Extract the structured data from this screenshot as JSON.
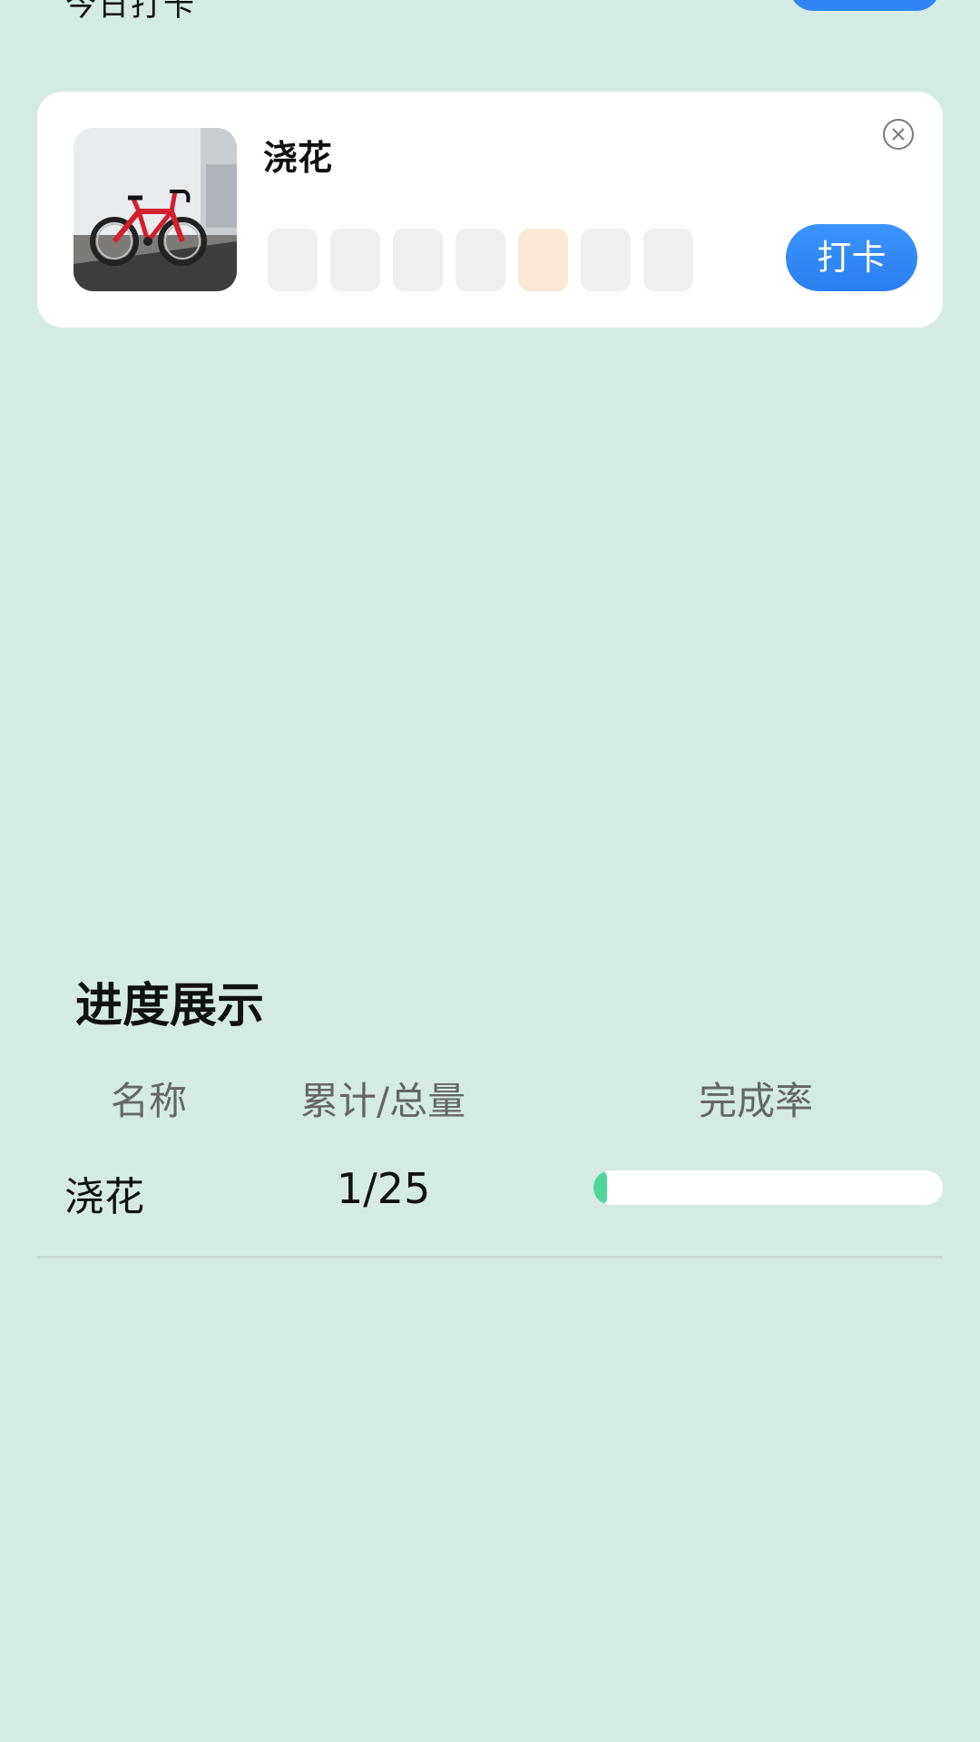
{
  "top": {
    "clipped_text": "今日打卡"
  },
  "task_card": {
    "name": "浇花",
    "checkin_label": "打卡",
    "days": [
      {
        "state": "empty"
      },
      {
        "state": "empty"
      },
      {
        "state": "empty"
      },
      {
        "state": "empty"
      },
      {
        "state": "today"
      },
      {
        "state": "empty"
      },
      {
        "state": "empty"
      }
    ]
  },
  "progress": {
    "title": "进度展示",
    "headers": {
      "name": "名称",
      "total": "累计/总量",
      "rate": "完成率"
    },
    "rows": [
      {
        "name": "浇花",
        "total": "1/25",
        "completed": 1,
        "goal": 25
      }
    ]
  },
  "colors": {
    "background": "#d5eae3",
    "accent_blue": "#2f86f4",
    "progress_green": "#4fd79b",
    "today_cell": "#fbe9d7"
  }
}
